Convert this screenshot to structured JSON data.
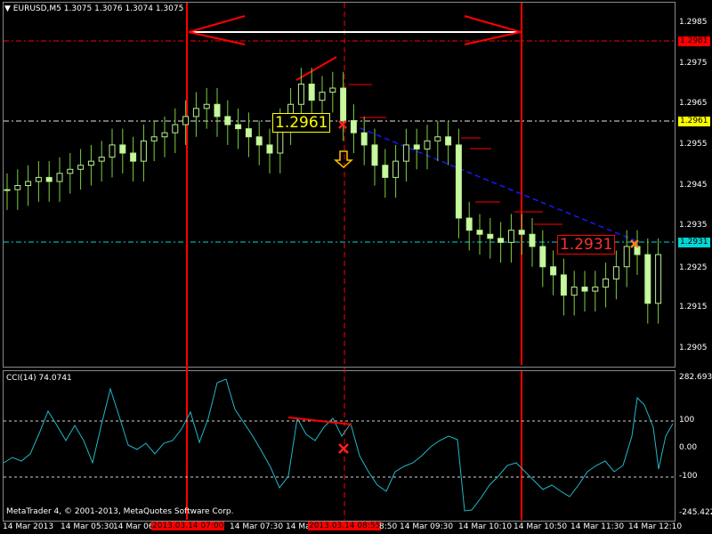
{
  "window": {
    "symbol_header": "EURUSD,M5  1.3075 1.3076 1.3074 1.3075",
    "collapse_icon": "triangle-down-icon"
  },
  "price_axis": {
    "labels": [
      "1.2985",
      "1.2975",
      "1.2965",
      "1.2955",
      "1.2945",
      "1.2935",
      "1.2925",
      "1.2915",
      "1.2905"
    ],
    "tags": {
      "top": "1.2981",
      "mid": "1.2961",
      "low": "1.2931"
    }
  },
  "annotations": {
    "box_high": "1.2961",
    "box_low": "1.2931",
    "arrow_icon": "down-arrow-icon",
    "x_marker_icon": "x-marker-icon",
    "colors": {
      "red": "#ff0000",
      "yellow": "#ffff00",
      "teal": "#00d8d8",
      "blue_dash": "#1818ff",
      "orange": "#ff8020",
      "candle": "#c8f8a0"
    }
  },
  "indicator": {
    "title": "CCI(14) 74.0741",
    "axis_labels": [
      "282.6935",
      "100",
      "0.00",
      "-100",
      "-245.4222"
    ],
    "copyright": "MetaTrader 4, © 2001-2013, MetaQuotes Software Corp."
  },
  "time_axis": {
    "labels": [
      "14 Mar 2013",
      "14 Mar 05:30",
      "14 Mar 06",
      "14 Mar 07:30",
      "14 Mar 0",
      "8:50",
      "14 Mar 09:30",
      "14 Mar 10:10",
      "14 Mar 10:50",
      "14 Mar 11:30",
      "14 Mar 12:10"
    ],
    "highlight_1": "2013.03.14 07:00",
    "highlight_2": "2013.03.14 08:55"
  },
  "chart_data": {
    "type": "candlestick",
    "symbol": "EURUSD",
    "timeframe": "M5",
    "ylim": [
      1.29,
      1.299
    ],
    "horizontal_levels": [
      1.2981,
      1.2961,
      1.2931
    ],
    "close_series": [
      1.2944,
      1.2945,
      1.2946,
      1.2947,
      1.2946,
      1.2948,
      1.2949,
      1.295,
      1.2951,
      1.2952,
      1.2955,
      1.2953,
      1.2951,
      1.2956,
      1.2957,
      1.2958,
      1.296,
      1.2962,
      1.2964,
      1.2965,
      1.2962,
      1.296,
      1.2959,
      1.2957,
      1.2955,
      1.2953,
      1.296,
      1.2965,
      1.297,
      1.2966,
      1.2968,
      1.2969,
      1.2961,
      1.2958,
      1.2955,
      1.295,
      1.2947,
      1.2951,
      1.2955,
      1.2954,
      1.2956,
      1.2957,
      1.2955,
      1.2937,
      1.2934,
      1.2933,
      1.2932,
      1.2931,
      1.2934,
      1.2933,
      1.293,
      1.2925,
      1.2923,
      1.2918,
      1.292,
      1.2919,
      1.292,
      1.2922,
      1.2925,
      1.293,
      1.2928,
      1.2916,
      1.2928
    ]
  }
}
